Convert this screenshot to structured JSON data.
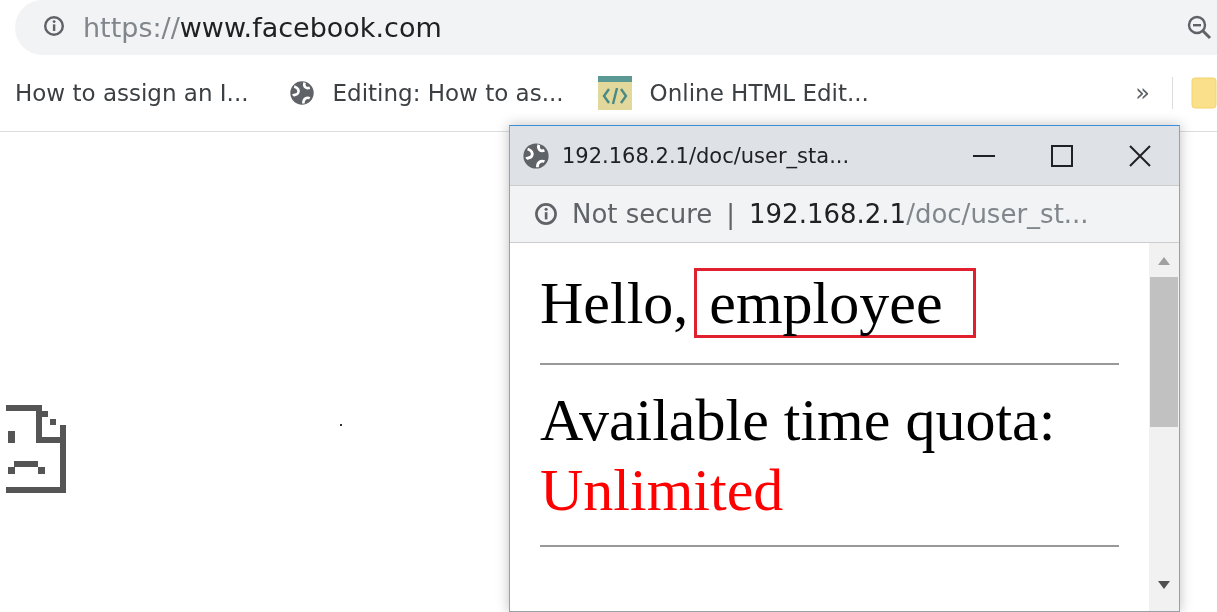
{
  "address_bar": {
    "scheme": "https://",
    "host": "www.facebook.com"
  },
  "bookmarks": [
    {
      "label": "How to assign an I...",
      "kind": "plain"
    },
    {
      "label": "Editing: How to as...",
      "kind": "globe"
    },
    {
      "label": "Online HTML Edit...",
      "kind": "code"
    }
  ],
  "bookmarks_overflow": "»",
  "popup": {
    "title": "192.168.2.1/doc/user_sta...",
    "security": "Not secure",
    "separator": "|",
    "url_host": "192.168.2.1",
    "url_path": "/doc/user_st...",
    "greeting": "Hello,",
    "user": "employee",
    "quota_label": "Available time quota:",
    "quota_value": "Unlimited"
  }
}
